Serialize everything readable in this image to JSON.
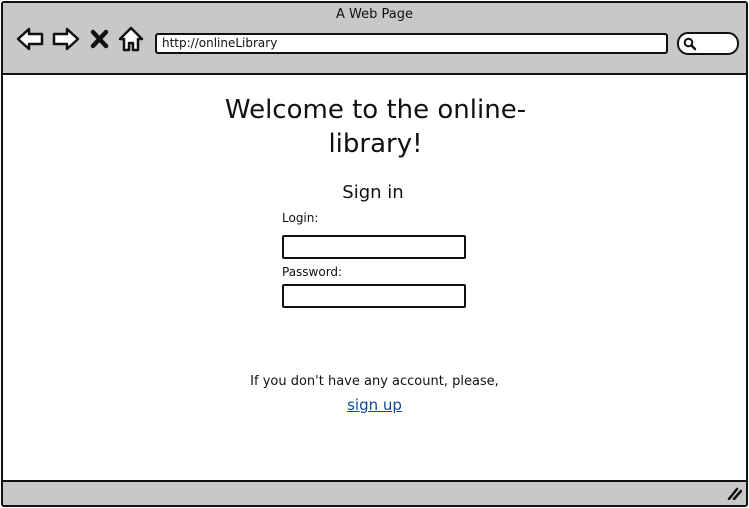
{
  "window": {
    "title": "A Web Page"
  },
  "toolbar": {
    "back_icon": "back-arrow-icon",
    "forward_icon": "forward-arrow-icon",
    "stop_icon": "close-icon",
    "home_icon": "home-icon",
    "url": "http://onlineLibrary",
    "search_icon": "search-icon"
  },
  "main": {
    "headline_line1": "Welcome to the online-",
    "headline_line2": "library!",
    "signin_title": "Sign in",
    "login_label": "Login:",
    "login_value": "",
    "password_label": "Password:",
    "password_value": "",
    "signup_prompt": "If you don't have any account, please,",
    "signup_link": "sign up"
  },
  "colors": {
    "chrome": "#c8c8c8",
    "border": "#111111",
    "link": "#0b4a9e",
    "background": "#ffffff"
  }
}
